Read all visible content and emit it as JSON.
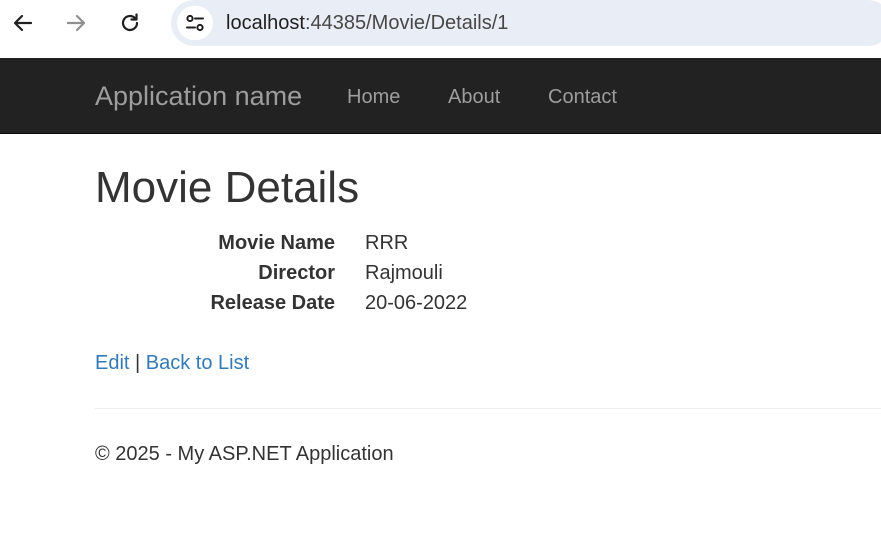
{
  "browser": {
    "url_host": "localhost",
    "url_path": ":44385/Movie/Details/1",
    "icons": {
      "back": "back-arrow-icon",
      "forward": "forward-arrow-icon",
      "reload": "reload-icon",
      "site_info": "tune-icon"
    }
  },
  "navbar": {
    "brand": "Application name",
    "links": [
      {
        "label": "Home"
      },
      {
        "label": "About"
      },
      {
        "label": "Contact"
      }
    ],
    "colors": {
      "background": "#222222",
      "link": "#9d9d9d"
    }
  },
  "main": {
    "title": "Movie Details",
    "details": [
      {
        "term": "Movie Name",
        "value": "RRR"
      },
      {
        "term": "Director",
        "value": "Rajmouli"
      },
      {
        "term": "Release Date",
        "value": "20-06-2022"
      }
    ],
    "actions": {
      "edit_label": "Edit",
      "separator": " | ",
      "back_label": "Back to List"
    },
    "link_color": "#337ab7"
  },
  "footer": {
    "text": "© 2025 - My ASP.NET Application"
  }
}
